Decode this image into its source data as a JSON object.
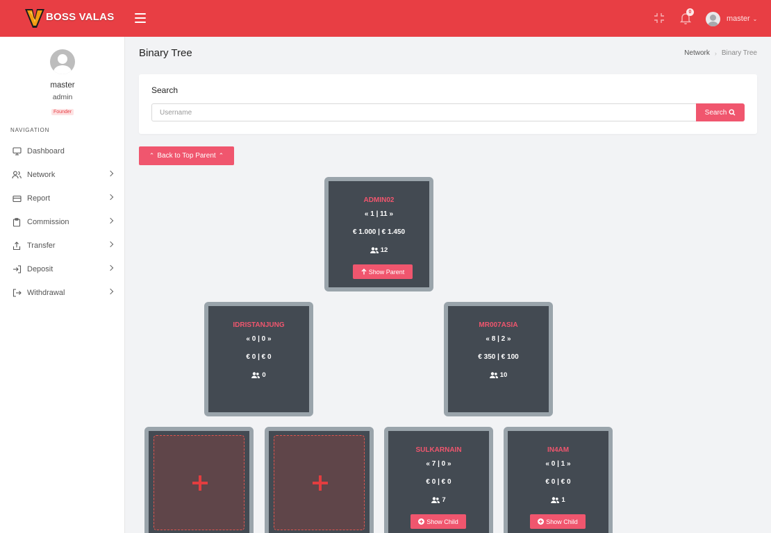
{
  "header": {
    "brand": "BOSS VALAS",
    "notification_count": "0",
    "user_name": "master"
  },
  "sidebar": {
    "profile": {
      "name": "master",
      "role": "admin",
      "badge": "Founder"
    },
    "nav_heading": "NAVIGATION",
    "items": [
      {
        "label": "Dashboard",
        "icon": "monitor-icon",
        "has_children": false
      },
      {
        "label": "Network",
        "icon": "users-icon",
        "has_children": true
      },
      {
        "label": "Report",
        "icon": "credit-card-icon",
        "has_children": true
      },
      {
        "label": "Commission",
        "icon": "clipboard-icon",
        "has_children": true
      },
      {
        "label": "Transfer",
        "icon": "share-icon",
        "has_children": true
      },
      {
        "label": "Deposit",
        "icon": "log-in-icon",
        "has_children": true
      },
      {
        "label": "Withdrawal",
        "icon": "log-out-icon",
        "has_children": true
      }
    ]
  },
  "page": {
    "title": "Binary Tree",
    "breadcrumb": [
      "Network",
      "Binary Tree"
    ]
  },
  "search": {
    "label": "Search",
    "placeholder": "Username",
    "value": "",
    "button_label": "Search"
  },
  "back_button_label": "Back to Top Parent",
  "tree": {
    "root": {
      "name": "ADMIN02",
      "lr": "« 1 | 11 »",
      "money": "€ 1.000 | € 1.450",
      "team": "12",
      "button": "Show Parent"
    },
    "left": {
      "name": "IDRISTANJUNG",
      "lr": "« 0 | 0 »",
      "money": "€ 0 | € 0",
      "team": "0"
    },
    "right": {
      "name": "MR007ASIA",
      "lr": "« 8 | 2 »",
      "money": "€ 350 | € 100",
      "team": "10"
    },
    "right_left": {
      "name": "SULKARNAIN",
      "lr": "« 7 | 0 »",
      "money": "€ 0 | € 0",
      "team": "7",
      "button": "Show Child"
    },
    "right_right": {
      "name": "IN4AM",
      "lr": "« 0 | 1 »",
      "money": "€ 0 | € 0",
      "team": "1",
      "button": "Show Child"
    }
  },
  "colors": {
    "header_bg": "#e83e44",
    "accent": "#f0566e",
    "node_frame": "#9aa4ab",
    "node_bg": "#434a52",
    "empty_slot_border": "#e0564f",
    "page_bg": "#f2f3f5"
  }
}
